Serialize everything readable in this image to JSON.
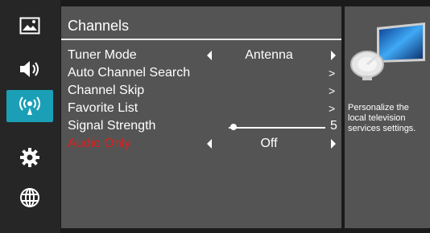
{
  "sidebar": {
    "items": [
      {
        "icon": "picture-icon"
      },
      {
        "icon": "speaker-icon"
      },
      {
        "icon": "broadcast-icon",
        "active": true
      },
      {
        "icon": "gear-icon"
      },
      {
        "icon": "globe-icon"
      }
    ]
  },
  "menu": {
    "title": "Channels",
    "rows": [
      {
        "label": "Tuner Mode",
        "value": "Antenna"
      },
      {
        "label": "Auto Channel Search",
        "chevron": ">"
      },
      {
        "label": "Channel Skip",
        "chevron": ">"
      },
      {
        "label": "Favorite List",
        "chevron": ">"
      },
      {
        "label": "Signal Strength",
        "value": "5",
        "level_fraction": 0.05
      },
      {
        "label": "Audio Only",
        "value": "Off"
      }
    ]
  },
  "info": {
    "description": "Personalize the local television services settings.",
    "illustration": "tv-with-satellite-dish-icon"
  },
  "colors": {
    "accent": "#1a9fb6",
    "panel": "#545454",
    "warning_text": "#e01f1f"
  }
}
